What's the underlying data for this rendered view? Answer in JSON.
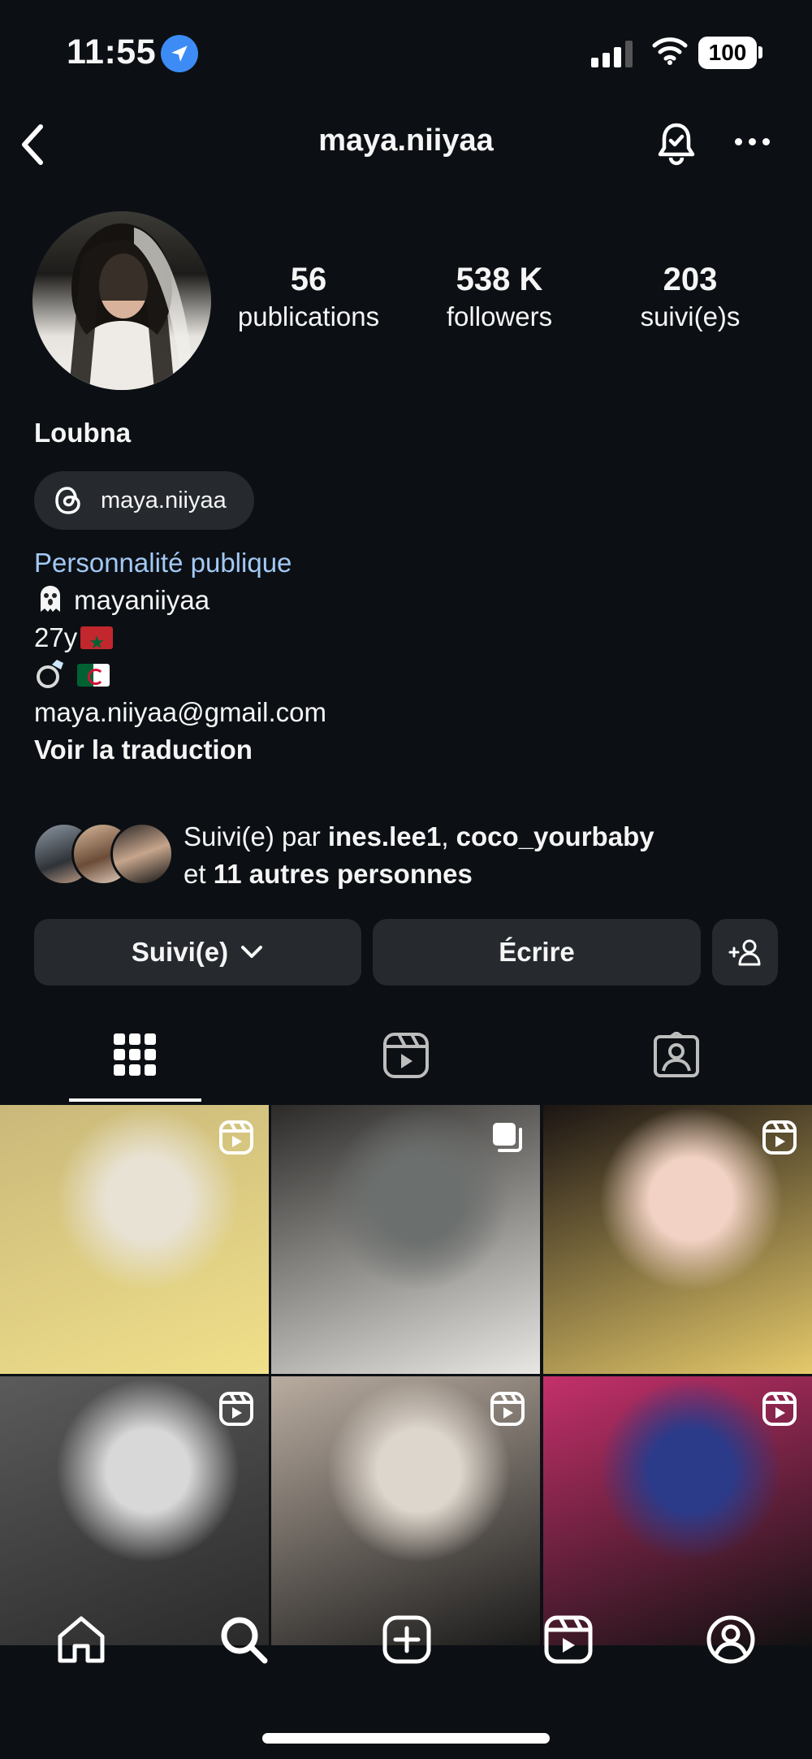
{
  "status_bar": {
    "time": "11:55",
    "battery": "100"
  },
  "header": {
    "username": "maya.niiyaa"
  },
  "stats": [
    {
      "value": "56",
      "label": "publications"
    },
    {
      "value": "538 K",
      "label": "followers"
    },
    {
      "value": "203",
      "label": "suivi(e)s"
    }
  ],
  "profile": {
    "name": "Loubna",
    "threads_handle": "maya.niiyaa",
    "category": "Personnalité publique",
    "bio_line1": "mayaniiyaa",
    "bio_line2": "27y",
    "email": "maya.niiyaa@gmail.com",
    "translate": "Voir la traduction"
  },
  "followed_by": {
    "prefix": "Suivi(e) par ",
    "user1": "ines.lee1",
    "sep": ", ",
    "user2": "coco_yourbaby",
    "line2_prefix": "et ",
    "others": "11 autres personnes"
  },
  "actions": {
    "following": "Suivi(e)",
    "message": "Écrire"
  },
  "grid": [
    {
      "type": "reel",
      "colors": [
        "#e8e2d4",
        "#c9b87a",
        "#f0e08a"
      ]
    },
    {
      "type": "carousel",
      "colors": [
        "#6b6f6d",
        "#2b2a28",
        "#e9e7e3"
      ]
    },
    {
      "type": "reel",
      "colors": [
        "#f2d2c4",
        "#1b1413",
        "#e5c96b"
      ]
    },
    {
      "type": "reel",
      "colors": [
        "#d8d8d8",
        "#5b5b5b",
        "#2a2a2a"
      ]
    },
    {
      "type": "reel",
      "colors": [
        "#ddd6cc",
        "#b9aca0",
        "#1a1a1a"
      ]
    },
    {
      "type": "reel",
      "colors": [
        "#2b3b8a",
        "#c4306b",
        "#111111"
      ]
    }
  ],
  "icons": {
    "back": "chevron-left-icon",
    "bell": "bell-icon",
    "more": "more-dots-icon",
    "threads": "threads-icon",
    "ghost": "ghost-emoji",
    "ring": "ring-emoji"
  },
  "colors": {
    "background": "#0c1014",
    "button": "#262a2f",
    "link": "#a3c9f5",
    "location": "#3d8cf5"
  }
}
